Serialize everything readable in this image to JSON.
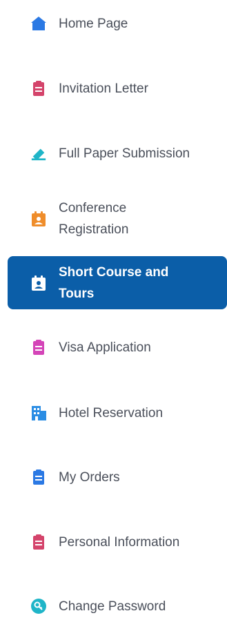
{
  "menu": {
    "items": [
      {
        "label": "Home Page",
        "icon": "home-icon",
        "color": "#2b79e4"
      },
      {
        "label": "Invitation Letter",
        "icon": "clipboard-icon",
        "color": "#d4446b"
      },
      {
        "label": "Full Paper Submission",
        "icon": "pen-icon",
        "color": "#1fb5c8"
      },
      {
        "label": "Conference Registration",
        "icon": "calendar-user-icon",
        "color": "#ef8d2b"
      },
      {
        "label": "Short Course and Tours",
        "icon": "calendar-user-icon",
        "color": "#ffffff",
        "active": true
      },
      {
        "label": "Visa Application",
        "icon": "clipboard-icon",
        "color": "#d444b8"
      },
      {
        "label": "Hotel Reservation",
        "icon": "building-icon",
        "color": "#2b8de4"
      },
      {
        "label": "My Orders",
        "icon": "clipboard-icon",
        "color": "#2b79e4"
      },
      {
        "label": "Personal Information",
        "icon": "clipboard-icon",
        "color": "#d4446b"
      },
      {
        "label": "Change Password",
        "icon": "key-icon",
        "color": "#1fb5c8"
      }
    ],
    "active_bg": "#0b5ea8"
  }
}
